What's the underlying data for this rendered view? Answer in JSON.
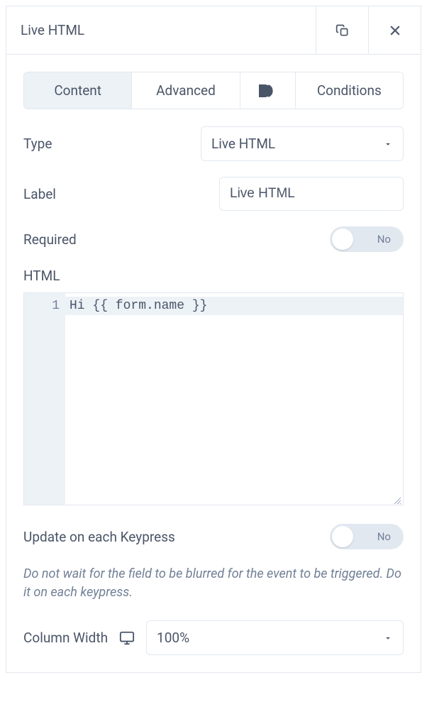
{
  "header": {
    "title": "Live HTML"
  },
  "tabs": {
    "content": "Content",
    "advanced": "Advanced",
    "conditions": "Conditions"
  },
  "fields": {
    "type": {
      "label": "Type",
      "value": "Live HTML"
    },
    "label": {
      "label": "Label",
      "value": "Live HTML"
    },
    "required": {
      "label": "Required",
      "value": "No"
    },
    "html": {
      "label": "HTML",
      "lineNumber": "1",
      "code": "Hi {{ form.name }}"
    },
    "updateKeypress": {
      "label": "Update on each Keypress",
      "value": "No",
      "help": "Do not wait for the field to be blurred for the event to be triggered. Do it on each keypress."
    },
    "columnWidth": {
      "label": "Column Width",
      "value": "100%"
    }
  }
}
